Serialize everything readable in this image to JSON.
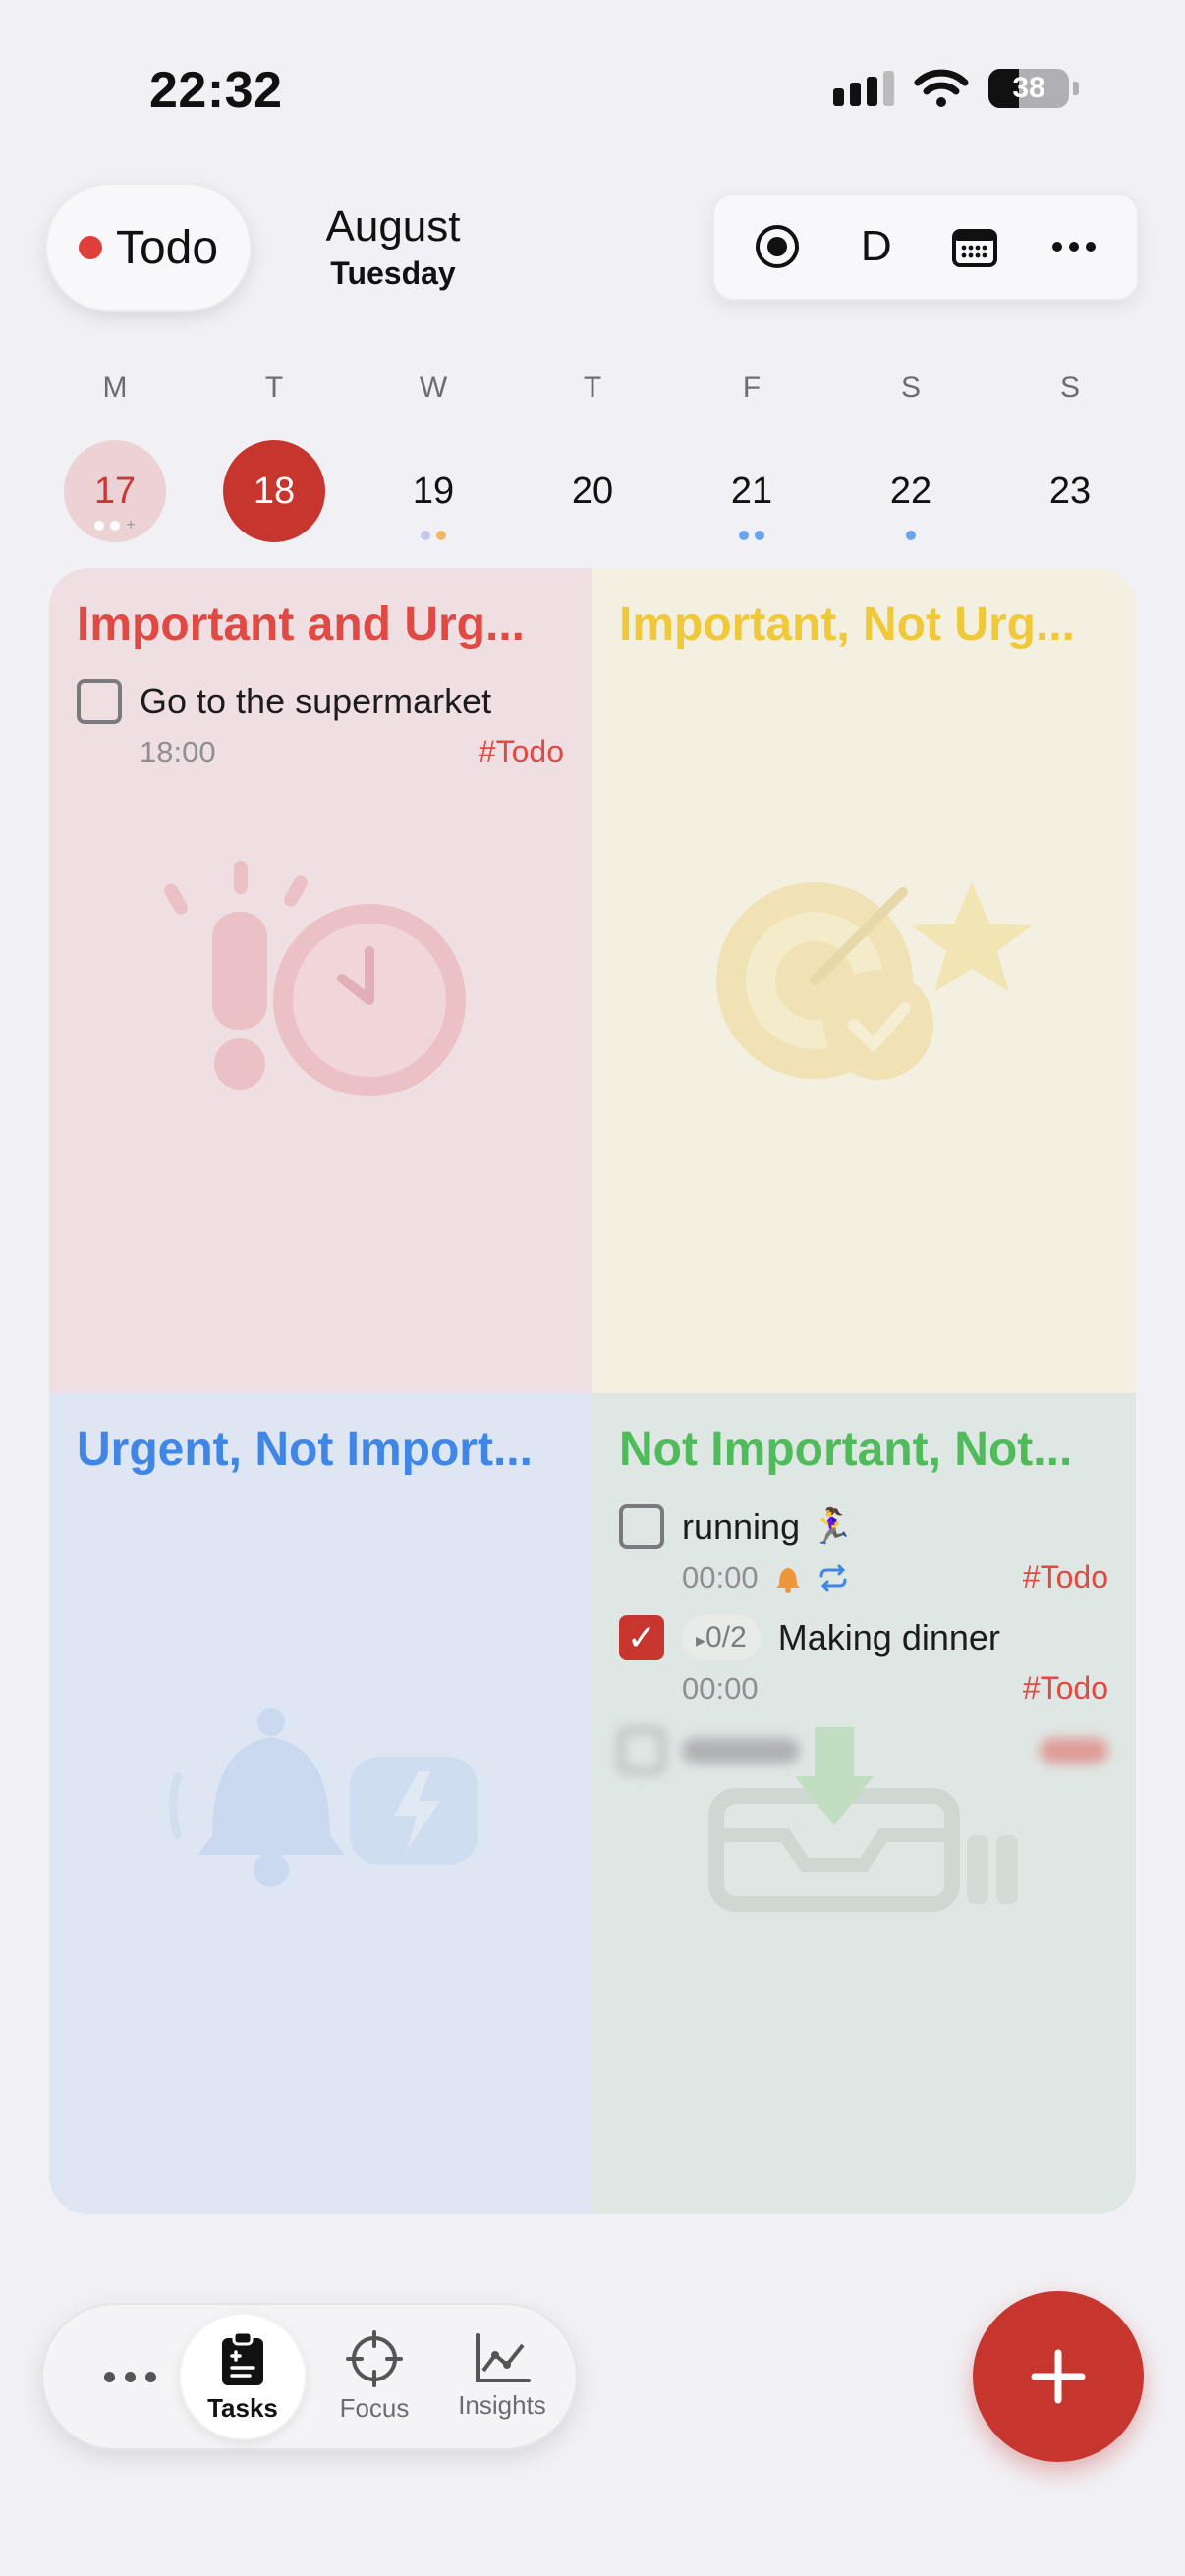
{
  "status_bar": {
    "time": "22:32",
    "battery": "38"
  },
  "header": {
    "list_label": "Todo",
    "list_color": "#e03e3a",
    "month": "August",
    "weekday": "Tuesday",
    "toolbar": {
      "mode_letter": "D"
    }
  },
  "week": {
    "days": [
      {
        "letter": "M",
        "num": "17"
      },
      {
        "letter": "T",
        "num": "18"
      },
      {
        "letter": "W",
        "num": "19"
      },
      {
        "letter": "T",
        "num": "20"
      },
      {
        "letter": "F",
        "num": "21"
      },
      {
        "letter": "S",
        "num": "22"
      },
      {
        "letter": "S",
        "num": "23"
      }
    ]
  },
  "matrix": {
    "q1": {
      "title": "Important and Urg...",
      "tasks": [
        {
          "title": "Go to the supermarket",
          "time": "18:00",
          "tag": "#Todo"
        }
      ]
    },
    "q2": {
      "title": "Important, Not Urg..."
    },
    "q3": {
      "title": "Urgent, Not Import..."
    },
    "q4": {
      "title": "Not Important, Not...",
      "tasks": [
        {
          "title": "running 🏃‍♀️",
          "time": "00:00",
          "tag": "#Todo"
        },
        {
          "title": "Making dinner",
          "subtasks": "0/2",
          "time": "00:00",
          "tag": "#Todo"
        }
      ]
    }
  },
  "tabbar": {
    "tasks": "Tasks",
    "focus": "Focus",
    "insights": "Insights"
  },
  "colors": {
    "accent": "#c7352f"
  }
}
